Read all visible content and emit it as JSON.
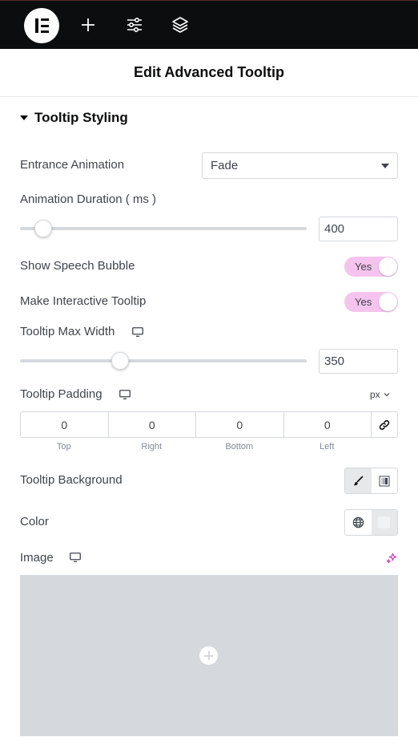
{
  "panel": {
    "title": "Edit Advanced Tooltip"
  },
  "toolbar": {
    "icons": [
      "elementor-logo",
      "add-icon",
      "settings-sliders-icon",
      "layers-icon"
    ]
  },
  "section": {
    "title": "Tooltip Styling"
  },
  "entrance_animation": {
    "label": "Entrance Animation",
    "value": "Fade"
  },
  "animation_duration": {
    "label": "Animation Duration ( ms )",
    "value": "400",
    "slider_fraction": 0.08
  },
  "speech_bubble": {
    "label": "Show Speech Bubble",
    "value": "Yes"
  },
  "interactive": {
    "label": "Make Interactive Tooltip",
    "value": "Yes"
  },
  "max_width": {
    "label": "Tooltip Max Width",
    "value": "350",
    "slider_fraction": 0.35
  },
  "padding": {
    "label": "Tooltip Padding",
    "unit": "px",
    "values": [
      "0",
      "0",
      "0",
      "0"
    ],
    "sides": [
      "Top",
      "Right",
      "Bottom",
      "Left"
    ]
  },
  "background": {
    "label": "Tooltip Background"
  },
  "color": {
    "label": "Color"
  },
  "image": {
    "label": "Image"
  },
  "colors": {
    "toggle_on": "#f4c4ee",
    "accent": "#d63eb8",
    "topbar": "#0c0d0e"
  }
}
